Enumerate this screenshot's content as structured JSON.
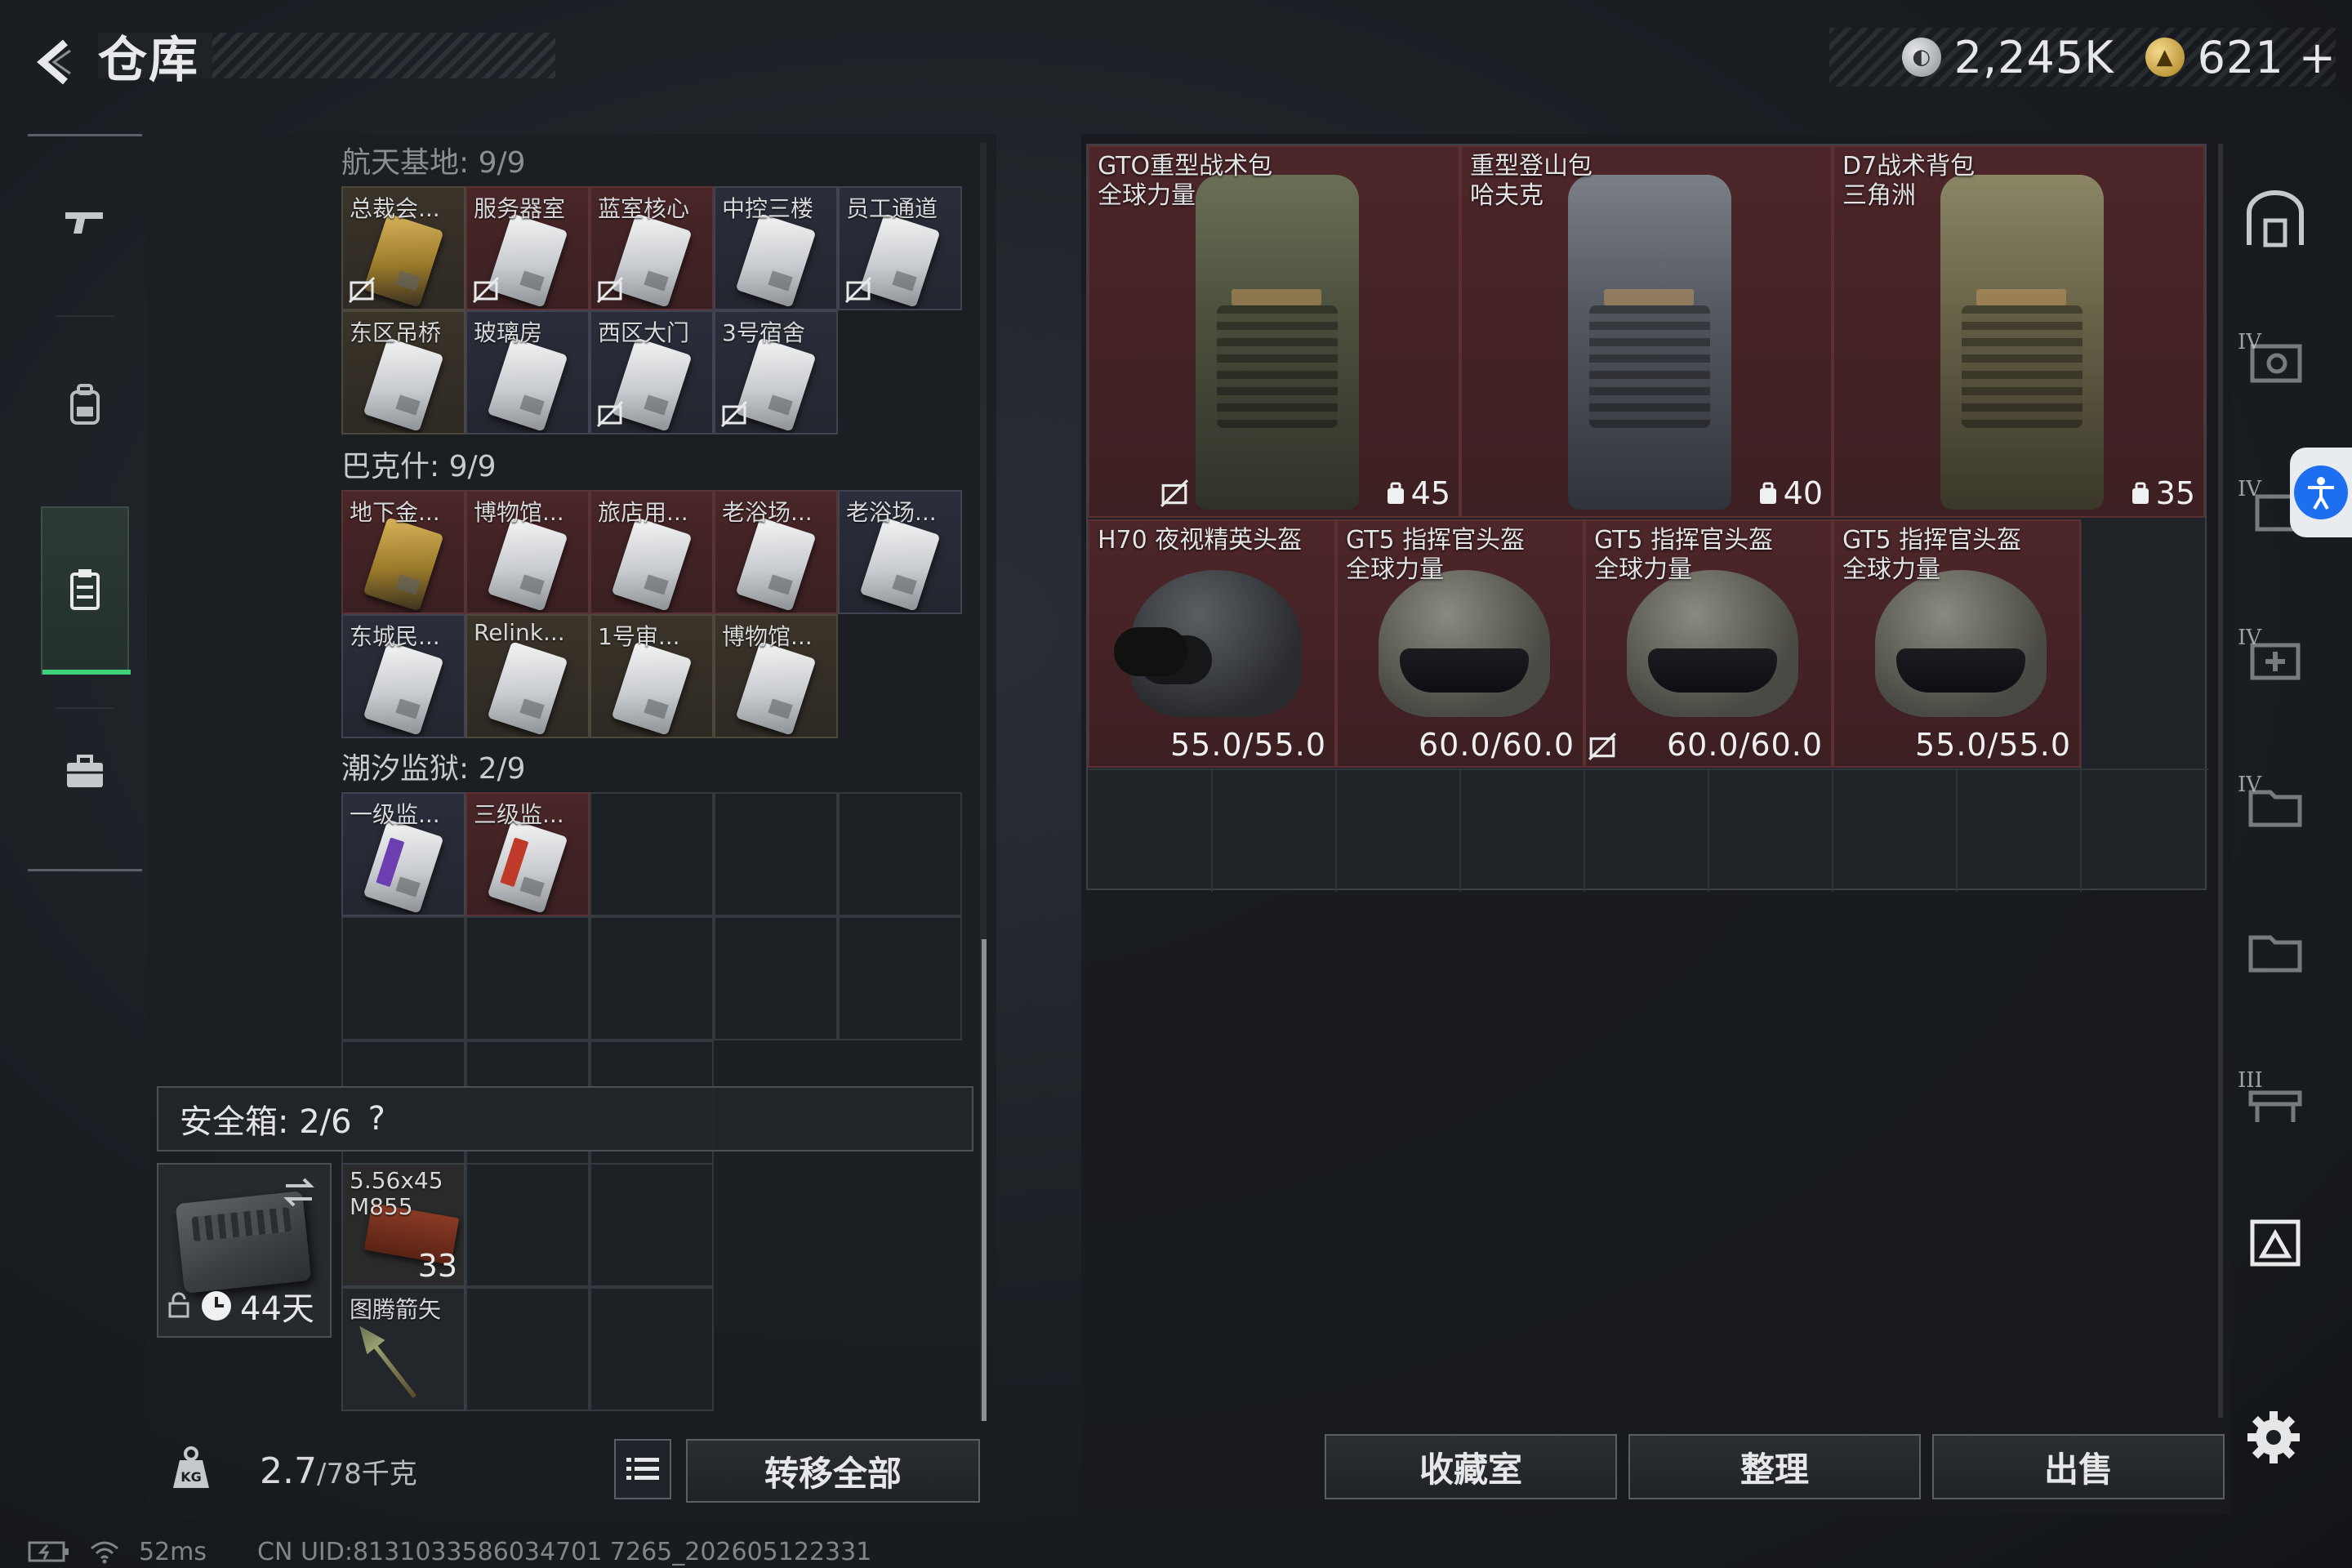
{
  "header": {
    "title": "仓库",
    "currency": [
      {
        "icon": "silver-coin-icon",
        "value": "2,245K"
      },
      {
        "icon": "gold-coin-icon",
        "value": "621",
        "plus": "+"
      }
    ]
  },
  "stash": {
    "sections": [
      {
        "label": "航天基地: 9/9",
        "items": [
          {
            "name": "总裁会...",
            "style": "gold",
            "card": "goldcard",
            "notrade": true
          },
          {
            "name": "服务器室",
            "style": "red",
            "card": "",
            "notrade": true
          },
          {
            "name": "蓝室核心",
            "style": "red",
            "card": "",
            "notrade": true
          },
          {
            "name": "中控三楼",
            "style": "blue",
            "card": "",
            "notrade": false
          },
          {
            "name": "员工通道",
            "style": "blue",
            "card": "",
            "notrade": true
          },
          {
            "name": "东区吊桥",
            "style": "gold",
            "card": "",
            "notrade": false
          },
          {
            "name": "玻璃房",
            "style": "blue",
            "card": "",
            "notrade": false
          },
          {
            "name": "西区大门",
            "style": "blue",
            "card": "",
            "notrade": true
          },
          {
            "name": "3号宿舍",
            "style": "blue",
            "card": "",
            "notrade": true
          }
        ]
      },
      {
        "label": "巴克什: 9/9",
        "items": [
          {
            "name": "地下金...",
            "style": "red",
            "card": "goldcard",
            "notrade": false
          },
          {
            "name": "博物馆...",
            "style": "red",
            "card": "",
            "notrade": false
          },
          {
            "name": "旅店用...",
            "style": "red",
            "card": "",
            "notrade": false
          },
          {
            "name": "老浴场...",
            "style": "red",
            "card": "",
            "notrade": false
          },
          {
            "name": "老浴场...",
            "style": "blue",
            "card": "",
            "notrade": false
          },
          {
            "name": "东城民...",
            "style": "blue",
            "card": "",
            "notrade": false
          },
          {
            "name": "Relink...",
            "style": "gold",
            "card": "",
            "notrade": false
          },
          {
            "name": "1号审...",
            "style": "gold",
            "card": "",
            "notrade": false
          },
          {
            "name": "博物馆...",
            "style": "gold",
            "card": "",
            "notrade": false
          }
        ]
      },
      {
        "label": "潮汐监狱: 2/9",
        "items": [
          {
            "name": "一级监...",
            "style": "blue",
            "card": "stripe-purple",
            "notrade": false
          },
          {
            "name": "三级监...",
            "style": "red",
            "card": "stripe-red",
            "notrade": false
          }
        ]
      }
    ]
  },
  "safe_box": {
    "label": "安全箱: 2/6",
    "help": "?",
    "days": "44天",
    "items": [
      {
        "name": "5.56x45\nM855",
        "count": "33"
      },
      {
        "name": "图腾箭矢",
        "count": ""
      }
    ]
  },
  "weight": {
    "current": "2.7",
    "max": "/78千克"
  },
  "buttons": {
    "transfer_all": "转移全部",
    "collection": "收藏室",
    "organize": "整理",
    "sell": "出售"
  },
  "equipment": {
    "backpacks": [
      {
        "name_line1": "GTO重型战术包",
        "name_line2": "全球力量",
        "capacity": "45",
        "notrade": true,
        "color": "green"
      },
      {
        "name_line1": "重型登山包",
        "name_line2": "哈夫克",
        "capacity": "40",
        "notrade": false,
        "color": "grey"
      },
      {
        "name_line1": "D7战术背包",
        "name_line2": "三角洲",
        "capacity": "35",
        "notrade": false,
        "color": "tan"
      }
    ],
    "helmets": [
      {
        "name_line1": "H70 夜视精英头盔",
        "name_line2": "",
        "durability": "55.0/55.0",
        "notrade": false,
        "type": "nv"
      },
      {
        "name_line1": "GT5 指挥官头盔",
        "name_line2": "全球力量",
        "durability": "60.0/60.0",
        "notrade": true,
        "type": "gt5"
      },
      {
        "name_line1": "GT5 指挥官头盔",
        "name_line2": "全球力量",
        "durability": "60.0/60.0",
        "notrade": false,
        "type": "gt5"
      },
      {
        "name_line1": "GT5 指挥官头盔",
        "name_line2": "全球力量",
        "durability": "55.0/55.0",
        "notrade": false,
        "type": "gt5"
      }
    ]
  },
  "rail": {
    "tiers": [
      "IV",
      "IV",
      "IV",
      "IV",
      "III"
    ]
  },
  "status": {
    "ping": "52ms",
    "uid": "CN UID:8131033586034701 7265_202605122331"
  },
  "colors": {
    "accent_green": "#3fd07a",
    "equipment_red": "#4d2629",
    "a11y_blue": "#1e6ef0"
  }
}
